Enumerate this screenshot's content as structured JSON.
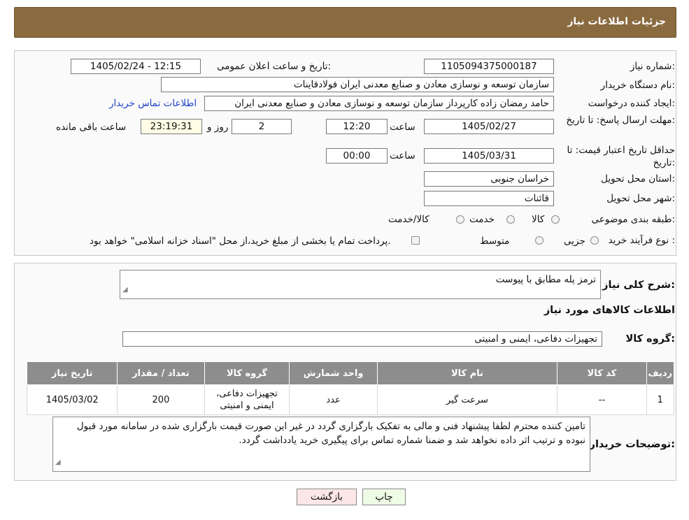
{
  "header": {
    "title": "جزئیات اطلاعات نیاز"
  },
  "form": {
    "need_number_label": "شماره نیاز:",
    "need_number": "1105094375000187",
    "announce_label": "تاریخ و ساعت اعلان عمومی:",
    "announce_value": "1405/02/24 - 12:15",
    "buyer_org_label": "نام دستگاه خریدار:",
    "buyer_org": "سازمان توسعه و نوسازی معادن و صنایع معدنی ایران فولادقاینات",
    "requester_label": "ایجاد کننده درخواست:",
    "requester": "حامد  رمضان زاده  کارپرداز  سازمان توسعه و نوسازی معادن و صنایع معدنی ایران",
    "contact_link": "اطلاعات تماس خریدار",
    "deadline_label": "مهلت ارسال پاسخ: تا تاریخ:",
    "deadline_date": "1405/02/27",
    "time_label": "ساعت",
    "deadline_time": "12:20",
    "days_value": "2",
    "days_label": "روز و",
    "remaining_value": "23:19:31",
    "remaining_label": "ساعت باقی مانده",
    "validity_label": "حداقل تاریخ اعتبار قیمت: تا تاریخ:",
    "validity_date": "1405/03/31",
    "validity_time_label": "ساعت",
    "validity_time": "00:00",
    "province_label": "استان محل تحویل:",
    "province": "خراسان جنوبی",
    "city_label": "شهر محل تحویل:",
    "city": "قائنات",
    "category_label": "طبقه بندی موضوعی:",
    "category_options": [
      "کالا",
      "خدمت",
      "کالا/خدمت"
    ],
    "process_label": "نوع فرآیند خرید :",
    "process_options": [
      "جزیی",
      "متوسط"
    ],
    "payment_note": "پرداخت تمام یا بخشی از مبلغ خرید،از محل \"اسناد خزانه اسلامی\" خواهد بود."
  },
  "summary": {
    "description_label": "شرح کلی نیاز:",
    "description": "ترمز پله مطابق با پیوست",
    "goods_info_title": "اطلاعات کالاهای مورد نیاز",
    "goods_group_label": "گروه کالا:",
    "goods_group": "تجهیزات دفاعی، ایمنی و امنیتی"
  },
  "table": {
    "headers": [
      "ردیف",
      "کد کالا",
      "نام کالا",
      "واحد شمارش",
      "گروه کالا",
      "تعداد / مقدار",
      "تاریخ نیاز"
    ],
    "rows": [
      [
        "1",
        "--",
        "سرعت گیر",
        "عدد",
        "تجهیزات دفاعی، ایمنی و امنیتی",
        "200",
        "1405/03/02"
      ]
    ]
  },
  "buyer_notes": {
    "label": "توضیحات خریدار:",
    "text": "تامین کننده محترم لطفا پیشنهاد فنی و مالی به تفکیک بارگزاری گردد در غیر این صورت قیمت بارگزاری شده در سامانه مورد قبول نبوده و ترتیب اثر داده نخواهد شد و ضمنا شماره تماس برای پیگیری خرید یادداشت گردد."
  },
  "buttons": {
    "print": "چاپ",
    "back": "بازگشت"
  },
  "colors": {
    "header_bg": "#8a6a3f",
    "table_header": "#8d8d8d",
    "print_bg": "#eefbe6",
    "back_bg": "#fde6e6",
    "link": "#2244cc"
  }
}
